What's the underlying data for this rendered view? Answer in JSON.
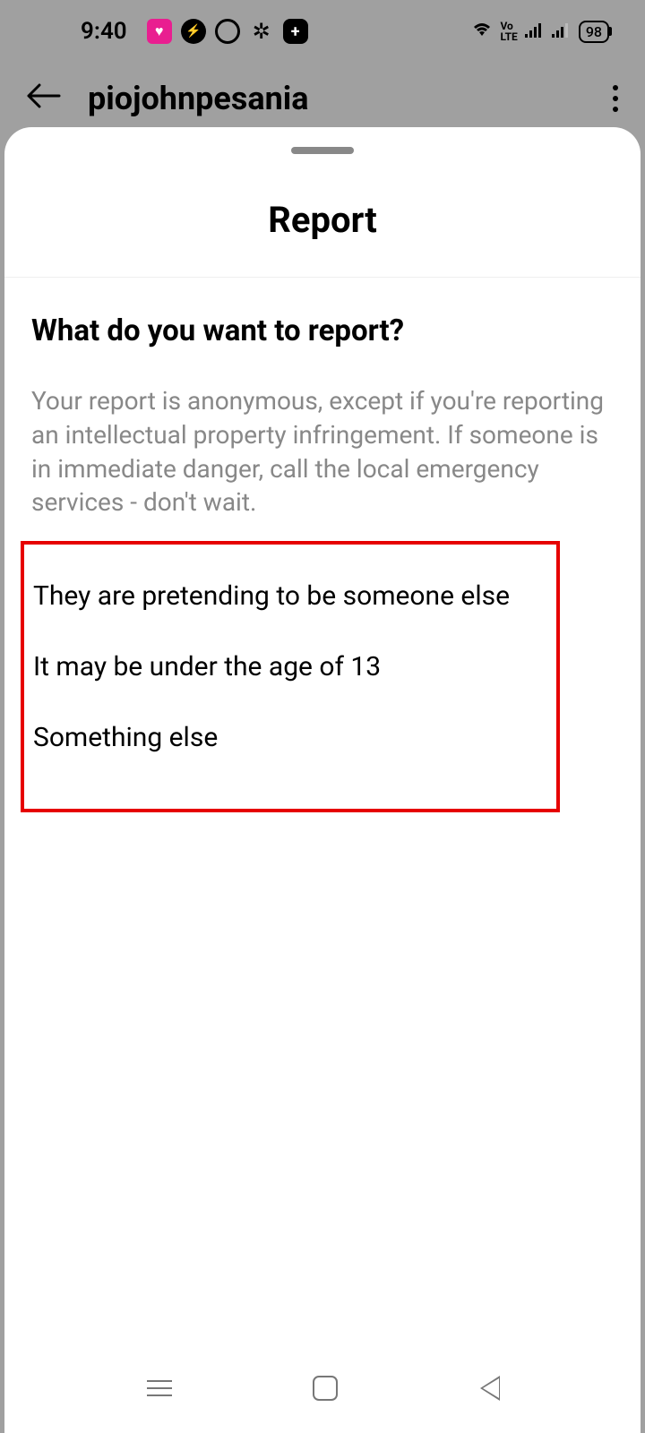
{
  "status": {
    "time": "9:40",
    "battery": "98"
  },
  "header": {
    "username": "piojohnpesania"
  },
  "report": {
    "title": "Report",
    "question": "What do you want to report?",
    "disclaimer": "Your report is anonymous, except if you're reporting an intellectual property infringement. If someone is in immediate danger, call the local emergency services - don't wait.",
    "options": [
      "They are pretending to be someone else",
      "It may be under the age of 13",
      "Something else"
    ]
  }
}
